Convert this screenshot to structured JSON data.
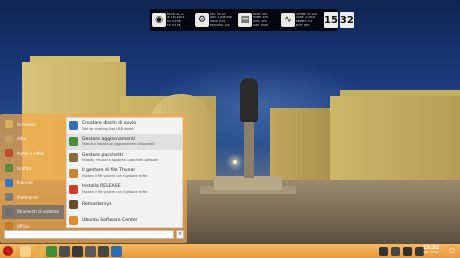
{
  "topbar": {
    "network": {
      "icon": "wifi-icon",
      "lines": [
        "ESSID: wl...A",
        "IP: 192.168.0",
        "RX: 0.0 KB",
        "TX: 0.0 KB"
      ]
    },
    "cpu": {
      "icon": "gear-icon",
      "lines": [
        "CPU: 4% 1m",
        "RAM: 1,2GB/3GB",
        "SWAP: 0.0%",
        "PROCESSI: 123"
      ]
    },
    "disk": {
      "icon": "hdd-icon",
      "lines": [
        "ROOT: 25%",
        "HOME: 40%",
        "DATA: 12%",
        "DISP: 30GB"
      ]
    },
    "system": {
      "icon": "pulse-icon",
      "lines": [
        "UPTIME: 0h 12m",
        "CORE: 4 LINUX",
        "KERNEL: 3.2",
        "BATT: 98%"
      ]
    },
    "clock": {
      "hours": "15",
      "minutes": "32"
    }
  },
  "menu": {
    "categories": [
      {
        "label": "Accessori",
        "color": "#d9b15b"
      },
      {
        "label": "Altro",
        "color": "#c79a5f"
      },
      {
        "label": "Audio e video",
        "color": "#c04b2d"
      },
      {
        "label": "Grafica",
        "color": "#5b8a3a"
      },
      {
        "label": "Internet",
        "color": "#2f78c4"
      },
      {
        "label": "Preferenze",
        "color": "#7a7a7a"
      },
      {
        "label": "Strumenti di sistema",
        "color": "#6f6f6f",
        "active": true
      },
      {
        "label": "Ufficio",
        "color": "#c47a2a"
      }
    ],
    "apps": [
      {
        "name": "Creatore dischi di avvio",
        "desc": "Tool for creating Live USB drives",
        "color": "#3b6fb6"
      },
      {
        "name": "Gestore aggiornamenti",
        "desc": "Mostra e installa gli aggiornamenti disponibili",
        "color": "#4a8b3b",
        "highlighted": true
      },
      {
        "name": "Gestore pacchetti",
        "desc": "Installa, rimuovi e aggiorna i pacchetti software",
        "color": "#8a6a3a"
      },
      {
        "name": "Il gestore di file Thunar",
        "desc": "Esplora il file system con il gestore di file",
        "color": "#c8842e"
      },
      {
        "name": "Installa RELEASE",
        "desc": "Esplora il file system con il gestore di file",
        "color": "#d23a2a"
      },
      {
        "name": "Remastersys",
        "desc": "",
        "color": "#6a4c2e"
      },
      {
        "name": "Ubuntu Software Center",
        "desc": "",
        "color": "#e08a30"
      }
    ],
    "search": {
      "placeholder": "",
      "button_icon": "search-icon"
    }
  },
  "taskbar": {
    "start_icon": "start-menu-icon",
    "launchers": [
      "terminal-icon",
      "folder-icon",
      "settings-icon",
      "files-icon",
      "text-editor-icon",
      "media-icon",
      "chat-icon",
      "browser-icon"
    ],
    "tray": [
      "network-icon",
      "volume-icon",
      "battery-icon",
      "update-icon"
    ],
    "clock": {
      "time": "15:32",
      "date": "Mer, 12 Set"
    },
    "power_icon": "power-icon"
  }
}
